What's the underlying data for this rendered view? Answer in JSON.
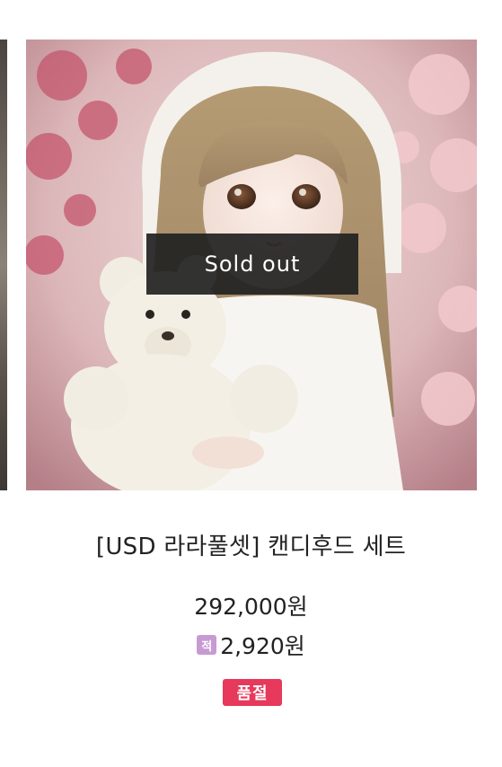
{
  "product": {
    "image_alt": "Doll in white hood holding a white teddy bear",
    "overlay_label": "Sold out",
    "name": "[USD 라라풀셋] 캔디후드 세트",
    "price": "292,000원",
    "points_badge": "적",
    "points_value": "2,920원",
    "status_badge": "품절"
  },
  "colors": {
    "overlay_bg": "#222222",
    "points_badge": "#c79bd2",
    "soldout_badge": "#e6395b"
  }
}
